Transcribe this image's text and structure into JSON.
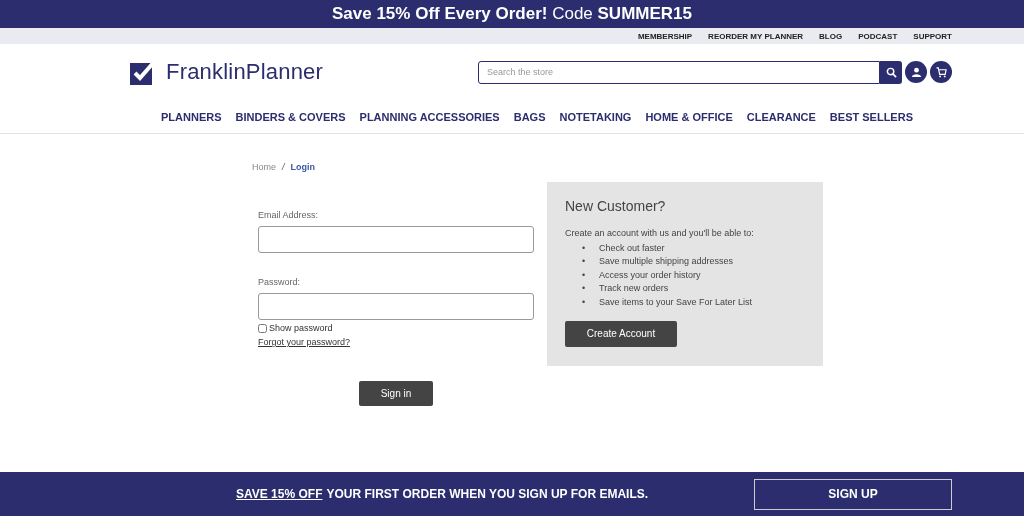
{
  "promo_bar": {
    "text": "**Save 15% Off Every Order!** Code **SUMMER15**"
  },
  "utility_links": [
    "MEMBERSHIP",
    "REORDER MY PLANNER",
    "BLOG",
    "PODCAST",
    "SUPPORT"
  ],
  "header": {
    "logo": "FranklinPlanner",
    "search": {
      "placeholder": "Search the store"
    }
  },
  "nav": [
    "PLANNERS",
    "BINDERS & COVERS",
    "PLANNING ACCESSORIES",
    "BAGS",
    "NOTETAKING",
    "HOME & OFFICE",
    "CLEARANCE",
    "BEST SELLERS"
  ],
  "breadcrumb": {
    "items": [
      "Home",
      "Login"
    ],
    "separator": "/"
  },
  "login_form": {
    "email_label": "Email Address:",
    "password_label": "Password:",
    "show_password": {
      "label": "Show password",
      "checked": false
    },
    "forgot_link": "Forgot your password?",
    "submit": "Sign in"
  },
  "new_customer": {
    "title": "New Customer?",
    "intro": "Create an account with us and you'll be able to:",
    "bullet": "•",
    "benefits": [
      "Check out faster",
      "Save multiple shipping addresses",
      "Access your order history",
      "Track new orders",
      "Save items to your Save For Later List"
    ],
    "button": "Create Account"
  },
  "signup_bar": {
    "link": "SAVE 15% OFF",
    "text": "YOUR FIRST ORDER WHEN YOU SIGN UP FOR EMAILS.",
    "button": "SIGN UP"
  }
}
